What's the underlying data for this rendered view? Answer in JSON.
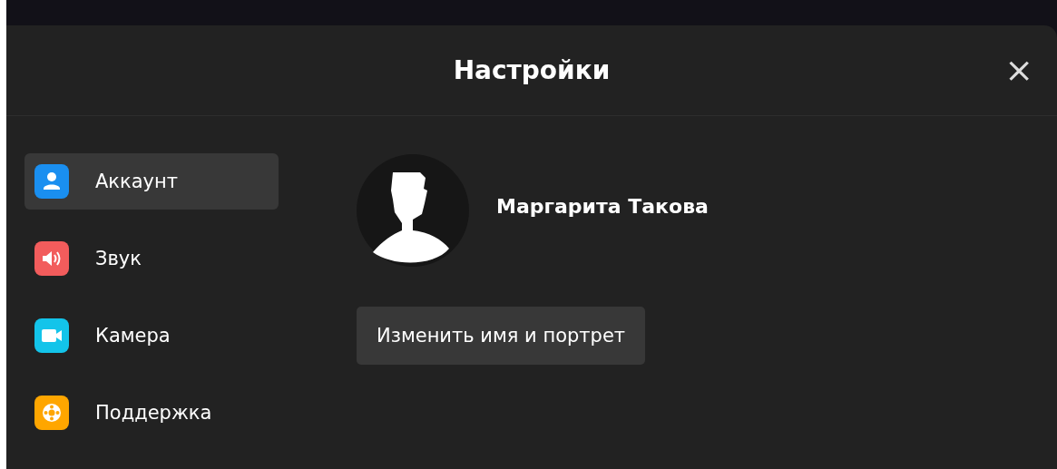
{
  "dialog": {
    "title": "Настройки",
    "close": "×"
  },
  "sidebar": {
    "items": [
      {
        "label": "Аккаунт",
        "kind": "person",
        "color": "#1a8ff0",
        "selected": true
      },
      {
        "label": "Звук",
        "kind": "speaker",
        "color": "#f25c5c",
        "selected": false
      },
      {
        "label": "Камера",
        "kind": "camera",
        "color": "#13c4ea",
        "selected": false
      },
      {
        "label": "Поддержка",
        "kind": "lifebuoy",
        "color": "#ffa600",
        "selected": false
      }
    ]
  },
  "account": {
    "name": "Маргарита Такова",
    "button": "Изменить имя и портрет"
  }
}
